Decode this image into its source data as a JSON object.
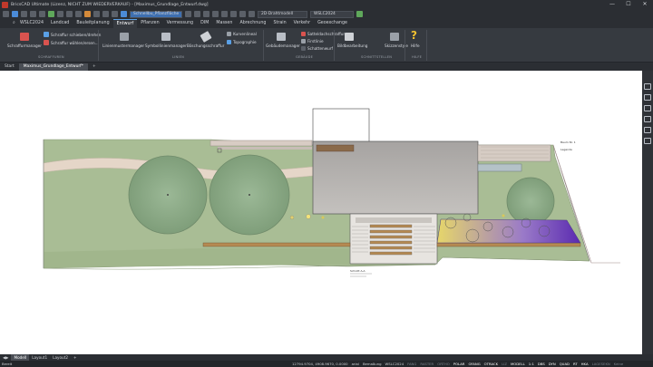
{
  "titlebar": {
    "title": "BricsCAD Ultimate (Lizenz, NICHT ZUM WIEDERVERKAUF) - [Maximus_Grundlage_Entwurf.dwg]",
    "minimize": "—",
    "maximize": "☐",
    "close": "✕"
  },
  "qat": {
    "workspace": "Schnellbu_Pflanzfläche",
    "visual_style": "2D-Drahtmodell",
    "profile": "WSLC2024"
  },
  "ribbon_tabs": [
    "WSLC2024",
    "Landcad",
    "Bauleitplanung",
    "Entwurf",
    "Pflanzen",
    "Vermessung",
    "DIM",
    "Massen",
    "Abrechnung",
    "Strain",
    "Verkehr",
    "Geoexchange"
  ],
  "active_tab": "Entwurf",
  "ribbon": {
    "schraffur": {
      "manager": "Schraffurmanager",
      "move_rotate": "Schraffur schieben/drehen",
      "select": "Schraffur wählen/ersen...",
      "panel": "SCHRAFFUREN"
    },
    "linien": {
      "linienmuster": "Linienmustermanager",
      "symbollinien": "Symbollinienmanager",
      "boeschung": "Böschungsschraffur",
      "kurvenlineal": "Kurvenlineal",
      "topographie": "Topographie",
      "panel": "LINIEN"
    },
    "gebaeude": {
      "manager": "Gebäudemanager",
      "dach": "Satteldachschraffur",
      "firstlinie": "Firstlinie",
      "schatten": "Schattenwurf",
      "panel": "GEBÄUDE"
    },
    "schnitt": {
      "bildbearbeitung": "Bildbearbeitung",
      "skizze": "Skizzenstyle",
      "panel": "SCHNITTSTELLEN"
    },
    "hilfe": {
      "label": "Hilfe",
      "panel": "HILFE"
    }
  },
  "file_tabs": [
    "Start",
    "Maximus_Grundlage_Entwurf*"
  ],
  "active_file": "Maximus_Grundlage_Entwurf*",
  "layout_tabs": [
    "Modell",
    "Layout1",
    "Layout2"
  ],
  "active_layout": "Modell",
  "status": {
    "left": "Bereit",
    "coords": "12794.9704, 4908.9670, 0.0000",
    "font": "arial",
    "dim": "Bemaßung",
    "profile": "WSLC2024",
    "toggles": [
      "FANG",
      "RASTER",
      "ORTHO",
      "POLAR",
      "OFANG",
      "OTRACK",
      "LIZ",
      "MODELL",
      "1:1",
      "DBS",
      "DYN",
      "QUAD",
      "RT",
      "HKA",
      "LAGESEKN",
      "Keine"
    ],
    "toggles_on": [
      "POLAR",
      "OFANG",
      "OTRACK",
      "MODELL",
      "1:1",
      "DBS",
      "DYN",
      "QUAD",
      "RT",
      "HKA"
    ]
  },
  "plan": {
    "label_small_1": "Baum Nr. 1",
    "label_small_2": "Legende",
    "label_bottom": "Schnitt A-A"
  },
  "colors": {
    "lawn": "#a9bd95",
    "lawn_dark": "#93a97d",
    "path": "#e5d6c8",
    "tree": "#8fae8a",
    "building": "#b0adaa",
    "gradient_start": "#e6d66a",
    "gradient_end": "#5a2ab0"
  }
}
